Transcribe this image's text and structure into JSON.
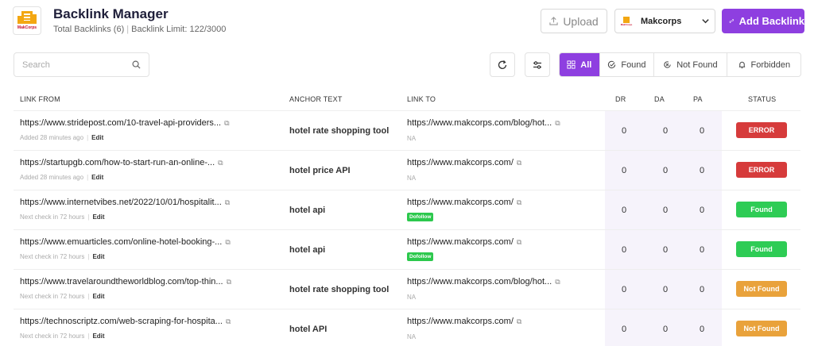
{
  "header": {
    "logo_text": "MakCorps",
    "title": "Backlink Manager",
    "total_backlinks": "Total Backlinks (6)",
    "backlink_limit": "Backlink Limit: 122/3000"
  },
  "actions": {
    "upload_label": "Upload",
    "company_name": "Makcorps",
    "company_logo_text": "MakCorps",
    "add_label": "Add Backlink"
  },
  "toolbar": {
    "search_placeholder": "Search",
    "filters": [
      {
        "label": "All",
        "active": true
      },
      {
        "label": "Found",
        "active": false
      },
      {
        "label": "Not Found",
        "active": false
      },
      {
        "label": "Forbidden",
        "active": false
      }
    ]
  },
  "table": {
    "columns": {
      "link_from": "LINK FROM",
      "anchor_text": "ANCHOR TEXT",
      "link_to": "LINK TO",
      "dr": "DR",
      "da": "DA",
      "pa": "PA",
      "status": "STATUS"
    },
    "rows": [
      {
        "link_from": "https://www.stridepost.com/10-travel-api-providers...",
        "meta": "Added 28 minutes ago",
        "edit": "Edit",
        "anchor": "hotel rate shopping tool",
        "link_to": "https://www.makcorps.com/blog/hot...",
        "sub": "NA",
        "dofollow": false,
        "dr": "0",
        "da": "0",
        "pa": "0",
        "status": "ERROR",
        "status_color": "#d63b3b"
      },
      {
        "link_from": "https://startupgb.com/how-to-start-run-an-online-...",
        "meta": "Added 28 minutes ago",
        "edit": "Edit",
        "anchor": "hotel price API",
        "link_to": "https://www.makcorps.com/",
        "sub": "NA",
        "dofollow": false,
        "dr": "0",
        "da": "0",
        "pa": "0",
        "status": "ERROR",
        "status_color": "#d63b3b"
      },
      {
        "link_from": "https://www.internetvibes.net/2022/10/01/hospitalit...",
        "meta": "Next check in 72 hours",
        "edit": "Edit",
        "anchor": "hotel api",
        "link_to": "https://www.makcorps.com/",
        "sub": "Dofollow",
        "dofollow": true,
        "dr": "0",
        "da": "0",
        "pa": "0",
        "status": "Found",
        "status_color": "#2ecc55"
      },
      {
        "link_from": "https://www.emuarticles.com/online-hotel-booking-...",
        "meta": "Next check in 72 hours",
        "edit": "Edit",
        "anchor": "hotel api",
        "link_to": "https://www.makcorps.com/",
        "sub": "Dofollow",
        "dofollow": true,
        "dr": "0",
        "da": "0",
        "pa": "0",
        "status": "Found",
        "status_color": "#2ecc55"
      },
      {
        "link_from": "https://www.travelaroundtheworldblog.com/top-thin...",
        "meta": "Next check in 72 hours",
        "edit": "Edit",
        "anchor": "hotel rate shopping tool",
        "link_to": "https://www.makcorps.com/blog/hot...",
        "sub": "NA",
        "dofollow": false,
        "dr": "0",
        "da": "0",
        "pa": "0",
        "status": "Not Found",
        "status_color": "#e9a23b"
      },
      {
        "link_from": "https://technoscriptz.com/web-scraping-for-hospita...",
        "meta": "Next check in 72 hours",
        "edit": "Edit",
        "anchor": "hotel API",
        "link_to": "https://www.makcorps.com/",
        "sub": "NA",
        "dofollow": false,
        "dr": "0",
        "da": "0",
        "pa": "0",
        "status": "Not Found",
        "status_color": "#e9a23b"
      }
    ]
  }
}
